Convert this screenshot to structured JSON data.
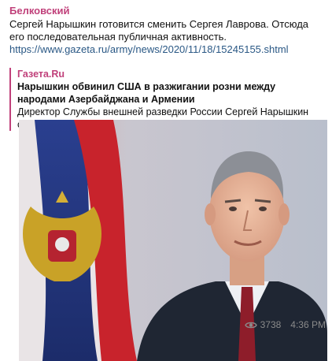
{
  "message": {
    "author": "Белковский",
    "text": "Сергей Нарышкин готовится сменить Сергея Лаврова. Отсюда его последовательная публичная активность.",
    "link": "https://www.gazeta.ru/army/news/2020/11/18/15245155.shtml"
  },
  "preview": {
    "site_name": "Газета.Ru",
    "title": "Нарышкин обвинил США в разжигании розни между народами Азербайджана и Армении",
    "description": "Директор Службы внешней разведки России Сергей Нарышкин считает, что Соединенные Штаты и союзники по ..."
  },
  "footer": {
    "views": "3738",
    "time": "4:36 PM",
    "views_icon": "eye-icon"
  },
  "colors": {
    "accent": "#c0407a",
    "link": "#2a5885",
    "meta": "#8a8a8a"
  }
}
